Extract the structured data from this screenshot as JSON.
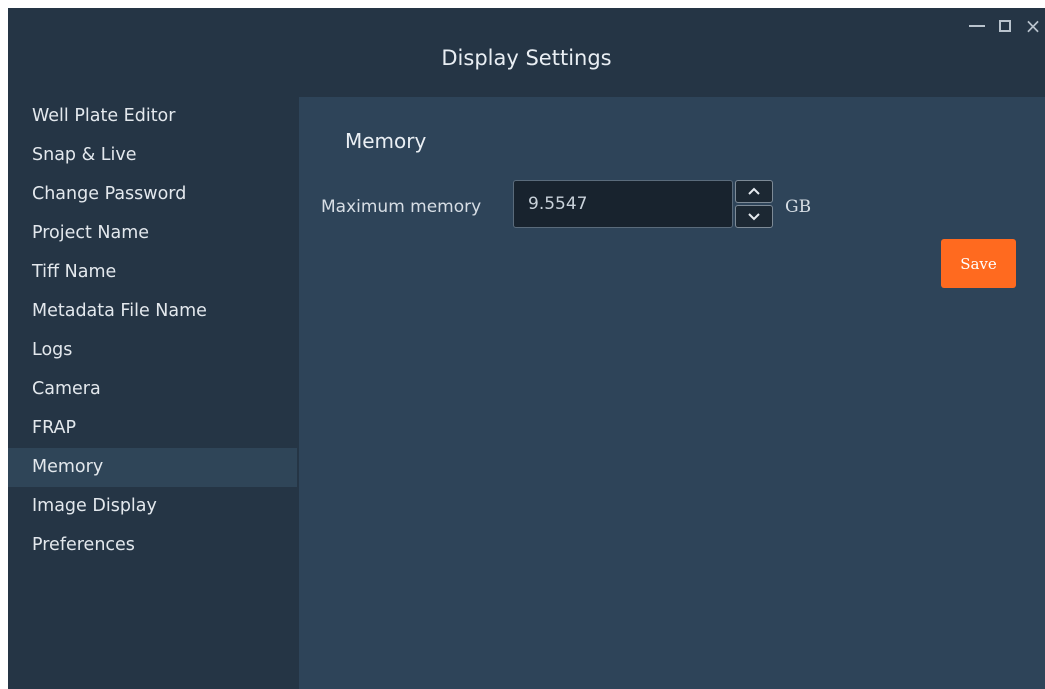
{
  "window": {
    "title": "Display Settings",
    "controls": [
      "minimize-icon",
      "maximize-icon",
      "close-icon"
    ],
    "close_glyph": "×"
  },
  "sidebar": {
    "items": [
      {
        "label": "Well Plate Editor"
      },
      {
        "label": "Snap & Live"
      },
      {
        "label": "Change Password"
      },
      {
        "label": "Project Name"
      },
      {
        "label": "Tiff Name"
      },
      {
        "label": "Metadata File Name"
      },
      {
        "label": "Logs"
      },
      {
        "label": "Camera"
      },
      {
        "label": "FRAP"
      },
      {
        "label": "Memory"
      },
      {
        "label": "Image Display"
      },
      {
        "label": "Preferences"
      }
    ],
    "selected": "Memory"
  },
  "main": {
    "section_title": "Memory",
    "max_memory": {
      "label": "Maximum memory",
      "value": "9.5547",
      "unit": "GB"
    },
    "save_label": "Save"
  },
  "colors": {
    "background": "#253545",
    "content_panel": "#2e4459",
    "selected_item": "#2f4558",
    "accent": "#ff6a1f"
  }
}
